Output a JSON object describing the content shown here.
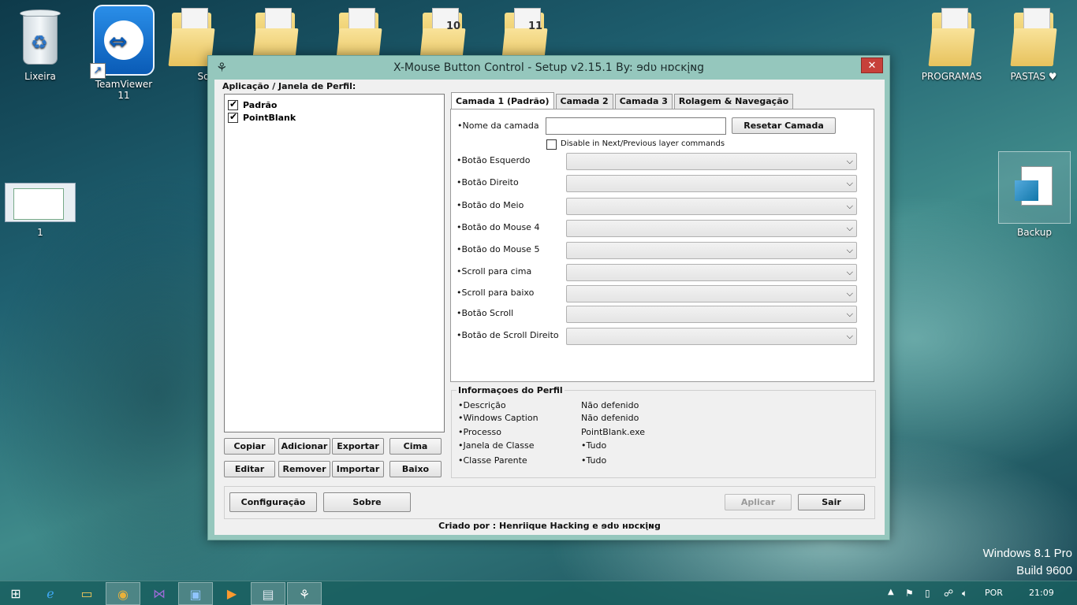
{
  "desktop": {
    "icons": [
      {
        "label": "Lixeira"
      },
      {
        "label": "TeamViewer 11"
      },
      {
        "label": "Sour"
      },
      {
        "label": "1"
      },
      {
        "label": "PROGRAMAS"
      },
      {
        "label": "PASTAS ♥"
      },
      {
        "label": "Backup"
      }
    ],
    "folder_badges": [
      "10",
      "11"
    ],
    "watermark": {
      "line1": "Windows 8.1 Pro",
      "line2": "Build 9600"
    }
  },
  "window": {
    "title": "X-Mouse Button Control - Setup v2.15.1 By: ɘdʋ ʜɒcĸįɴg",
    "close_label": "✕",
    "profiles": {
      "group_title": "Aplicação / Janela de Perfil:",
      "items": [
        {
          "label": "Padrão",
          "checked": true
        },
        {
          "label": "PointBlank",
          "checked": true
        }
      ],
      "buttons": {
        "copy": "Copiar",
        "add": "Adicionar",
        "export": "Exportar",
        "up": "Cima",
        "edit": "Editar",
        "remove": "Remover",
        "import": "Importar",
        "down": "Baixo"
      }
    },
    "tabs": [
      {
        "label": "Camada 1 (Padrão)",
        "active": true
      },
      {
        "label": "Camada 2"
      },
      {
        "label": "Camada 3"
      },
      {
        "label": "Rolagem & Navegação"
      }
    ],
    "layer": {
      "name_label": "•Nome da camada",
      "name_value": "",
      "reset_button": "Resetar Camada",
      "disable_label": "Disable in Next/Previous layer commands",
      "rows": [
        {
          "label": "•Botão Esquerdo",
          "value": ""
        },
        {
          "label": "•Botão Direito",
          "value": ""
        },
        {
          "label": "•Botão do Meio",
          "value": ""
        },
        {
          "label": "•Botão do Mouse 4",
          "value": ""
        },
        {
          "label": "•Botão do Mouse 5",
          "value": ""
        },
        {
          "label": "•Scroll para cima",
          "value": ""
        },
        {
          "label": "•Scroll para baixo",
          "value": ""
        },
        {
          "label": "•Botão Scroll",
          "value": ""
        },
        {
          "label": "•Botão de Scroll Direito",
          "value": ""
        }
      ]
    },
    "profile_info": {
      "title": "Informaçoes do Perfil",
      "rows": [
        {
          "label": "•Descrição",
          "value": "Não defenido"
        },
        {
          "label": "•Windows Caption",
          "value": "Não defenido"
        },
        {
          "label": "•Processo",
          "value": "PointBlank.exe"
        },
        {
          "label": "•Janela de Classe",
          "value": "•Tudo"
        },
        {
          "label": "•Classe Parente",
          "value": "•Tudo"
        }
      ]
    },
    "footer": {
      "config": "Configuração",
      "about": "Sobre",
      "apply": "Aplicar",
      "exit": "Sair",
      "credit": "Criado por : Henriique Hacking e ɘdʋ ʜɒcĸįɴg"
    }
  },
  "taskbar": {
    "language": "POR",
    "time": "21:09"
  }
}
